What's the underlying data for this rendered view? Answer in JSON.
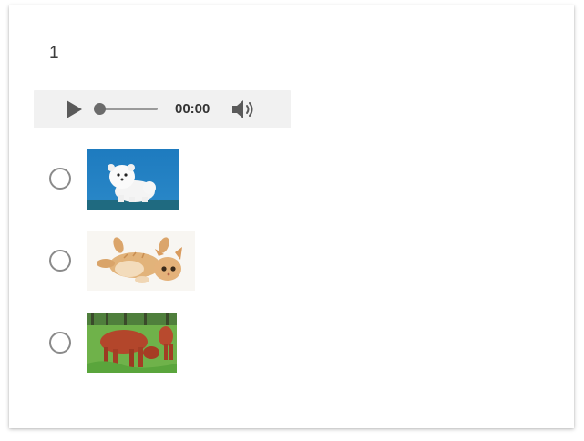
{
  "question": {
    "number": "1"
  },
  "audio_player": {
    "time": "00:00",
    "progress": 0,
    "play_icon": "play-icon",
    "volume_icon": "volume-icon"
  },
  "options": [
    {
      "image": "dog-picture"
    },
    {
      "image": "cat-picture"
    },
    {
      "image": "cow-picture"
    }
  ],
  "colors": {
    "player_background": "#f1f1f1",
    "radio_border": "#8a8a8a",
    "text": "#3c3c3c"
  }
}
